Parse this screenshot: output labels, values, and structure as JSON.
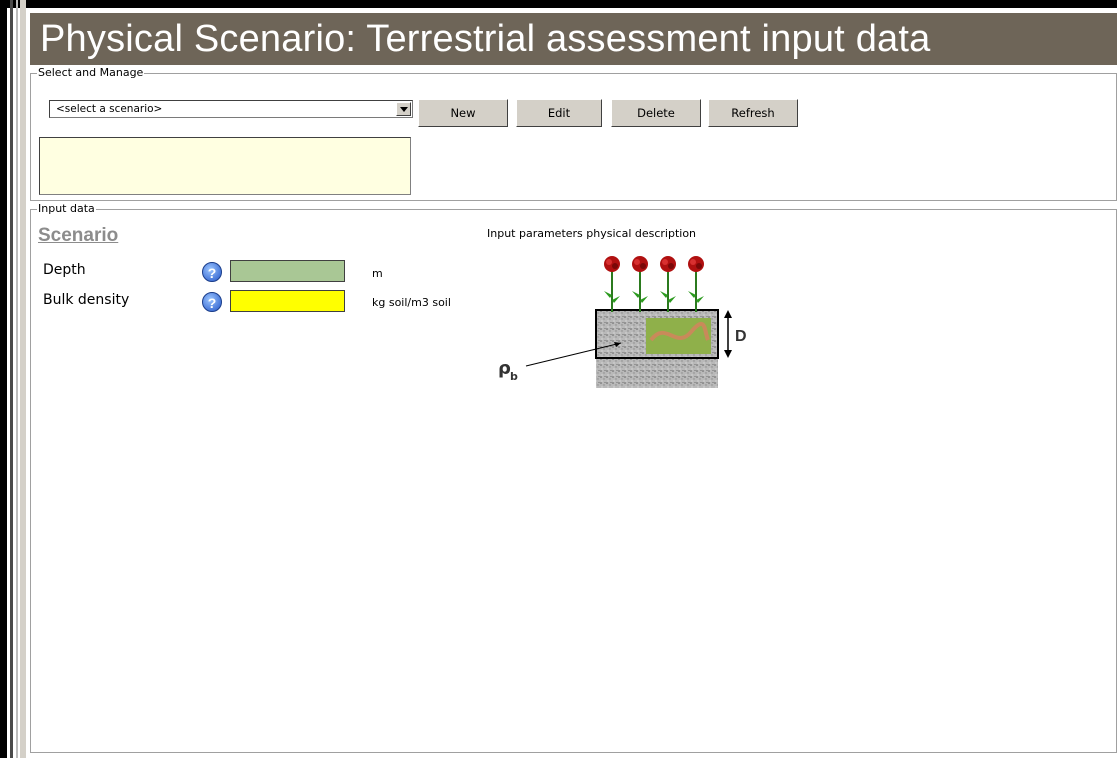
{
  "header": {
    "title": "Physical Scenario: Terrestrial assessment input data"
  },
  "select_manage": {
    "legend": "Select and Manage",
    "dropdown_value": "<select a scenario>",
    "buttons": {
      "new": "New",
      "edit": "Edit",
      "delete": "Delete",
      "refresh": "Refresh"
    }
  },
  "input_data": {
    "legend": "Input data",
    "section_title": "Scenario",
    "fields": [
      {
        "label": "Depth",
        "value": "",
        "unit": "m",
        "color": "#a9c795"
      },
      {
        "label": "Bulk density",
        "value": "",
        "unit": "kg soil/m3 soil",
        "color": "#ffff00"
      }
    ],
    "description_title": "Input parameters physical description",
    "diagram": {
      "rho_label": "ρ",
      "rho_sub": "b",
      "depth_label": "D"
    }
  },
  "colors": {
    "header_bg": "#6e6558",
    "note_bg": "#ffffe1"
  }
}
